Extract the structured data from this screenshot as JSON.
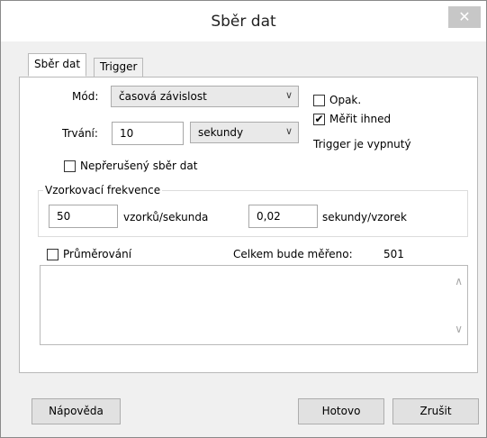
{
  "window": {
    "title": "Sběr dat",
    "close_icon": "close-icon"
  },
  "tabs": [
    {
      "label": "Sběr dat",
      "active": true
    },
    {
      "label": "Trigger",
      "active": false
    }
  ],
  "mode": {
    "label": "Mód:",
    "value": "časová závislost"
  },
  "duration": {
    "label": "Trvání:",
    "value": "10",
    "unit": "sekundy"
  },
  "repeat": {
    "label": "Opak.",
    "checked": false
  },
  "measure_now": {
    "label": "Měřit ihned",
    "checked": true
  },
  "trigger_status": "Trigger je vypnutý",
  "continuous": {
    "label": "Nepřerušený sběr dat",
    "checked": false
  },
  "sampling": {
    "group_label": "Vzorkovací frekvence",
    "rate_value": "50",
    "rate_unit": "vzorků/sekunda",
    "period_value": "0,02",
    "period_unit": "sekundy/vzorek"
  },
  "averaging": {
    "label": "Průměrování",
    "checked": false
  },
  "total": {
    "label": "Celkem bude měřeno:",
    "value": "501"
  },
  "buttons": {
    "help": "Nápověda",
    "done": "Hotovo",
    "cancel": "Zrušit"
  }
}
